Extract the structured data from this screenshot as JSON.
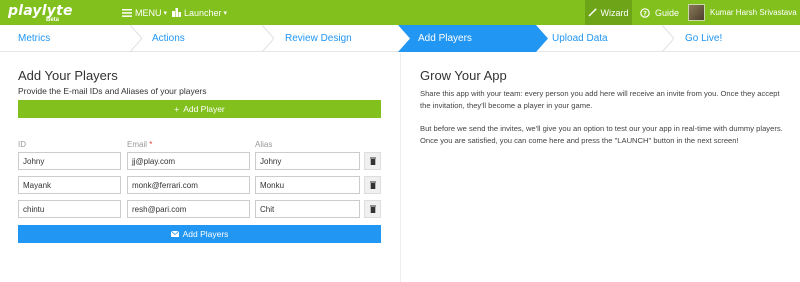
{
  "brand": {
    "logo_text": "playlyte",
    "logo_sub": "Beta"
  },
  "topnav": {
    "menu_label": "MENU",
    "launcher_label": "Launcher",
    "wizard_label": "Wizard",
    "guide_label": "Guide",
    "user_name": "Kumar Harsh Srivastava"
  },
  "steps": [
    {
      "label": "Metrics"
    },
    {
      "label": "Actions"
    },
    {
      "label": "Review Design"
    },
    {
      "label": "Add Players"
    },
    {
      "label": "Upload Data"
    },
    {
      "label": "Go Live!"
    }
  ],
  "active_step": "Add Players",
  "left": {
    "title": "Add Your Players",
    "subtitle": "Provide the E-mail IDs and Aliases of your players",
    "add_player_label": "Add Player",
    "columns": {
      "id": "ID",
      "email": "Email",
      "email_required": "*",
      "alias": "Alias"
    },
    "players": [
      {
        "id": "Johny",
        "email": "jj@play.com",
        "alias": "Johny"
      },
      {
        "id": "Mayank",
        "email": "monk@ferrari.com",
        "alias": "Monku"
      },
      {
        "id": "chintu",
        "email": "resh@pari.com",
        "alias": "Chit"
      }
    ],
    "submit_label": "Add Players"
  },
  "right": {
    "title": "Grow Your App",
    "para1": "Share this app with your team: every person you add here will receive an invite from you. Once they accept the invitation, they'll become a player in your game.",
    "para2": "But before we send the invites, we'll give you an option to test our your app in real-time with dummy players. Once you are satisfied, you can come here and press the \"LAUNCH\" button in the next screen!"
  },
  "colors": {
    "green": "#82c01d",
    "blue": "#2196f3",
    "wizard_bg": "#6ea417"
  }
}
